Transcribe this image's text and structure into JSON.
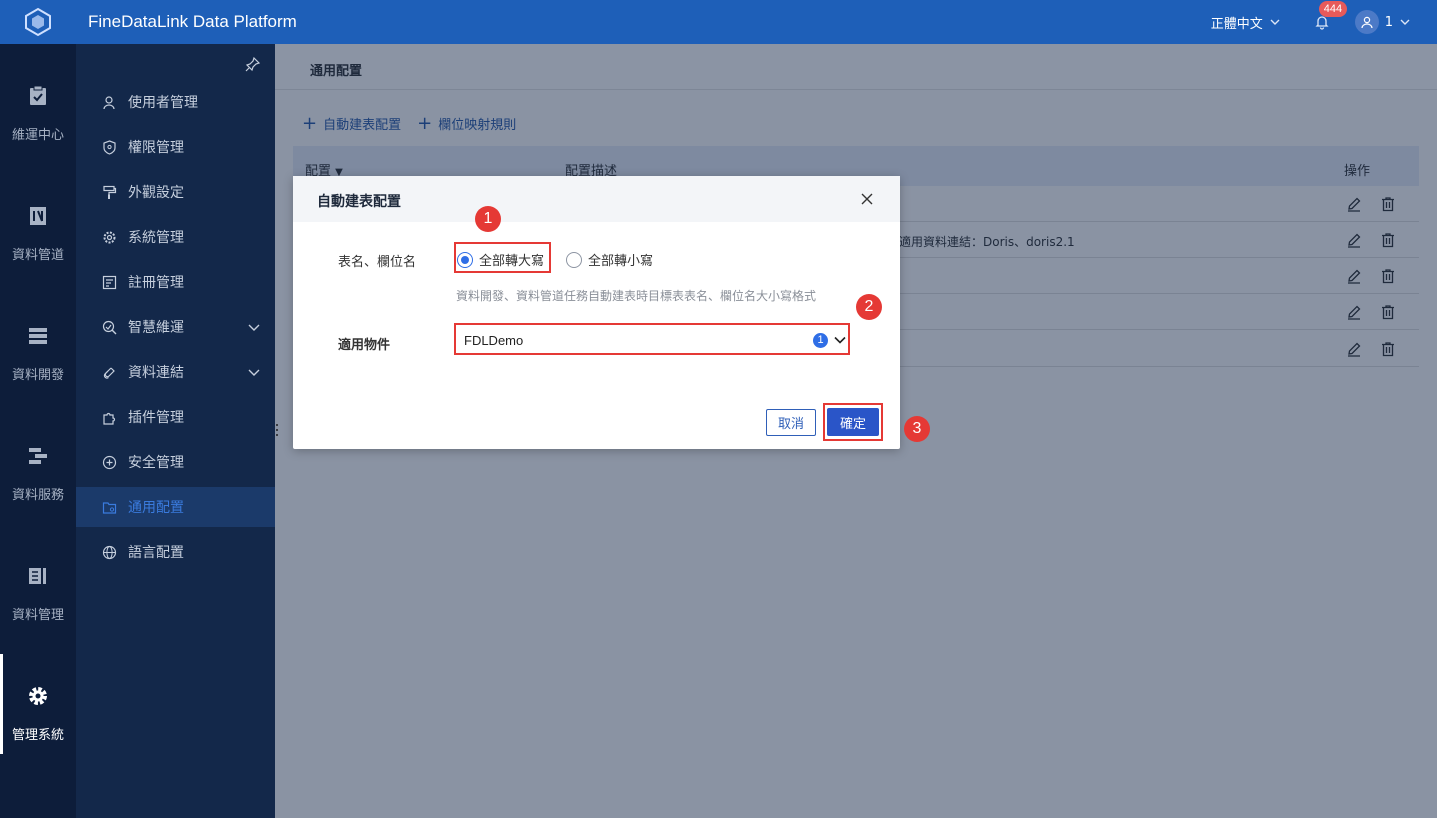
{
  "app": {
    "title": "FineDataLink Data Platform"
  },
  "topbar": {
    "language": "正體中文",
    "notification_count": "444",
    "user_name": "1"
  },
  "rail": {
    "items": [
      {
        "label": "維運中心",
        "icon": "clipboard-check-icon"
      },
      {
        "label": "資料管道",
        "icon": "pipeline-icon"
      },
      {
        "label": "資料開發",
        "icon": "server-stack-icon"
      },
      {
        "label": "資料服務",
        "icon": "service-icon"
      },
      {
        "label": "資料管理",
        "icon": "book-icon"
      },
      {
        "label": "管理系統",
        "icon": "gear-icon",
        "active": true
      }
    ]
  },
  "submenu": {
    "items": [
      {
        "label": "使用者管理",
        "icon": "user-icon"
      },
      {
        "label": "權限管理",
        "icon": "shield-icon"
      },
      {
        "label": "外觀設定",
        "icon": "paint-roller-icon"
      },
      {
        "label": "系統管理",
        "icon": "gear-icon"
      },
      {
        "label": "註冊管理",
        "icon": "register-icon"
      },
      {
        "label": "智慧維運",
        "icon": "smart-ops-icon",
        "expandable": true
      },
      {
        "label": "資料連結",
        "icon": "link-icon",
        "expandable": true
      },
      {
        "label": "插件管理",
        "icon": "puzzle-icon"
      },
      {
        "label": "安全管理",
        "icon": "security-plus-icon"
      },
      {
        "label": "通用配置",
        "icon": "folder-settings-icon",
        "active": true
      },
      {
        "label": "語言配置",
        "icon": "globe-icon"
      }
    ]
  },
  "main": {
    "breadcrumb": "通用配置",
    "toolbar": {
      "auto_table_label": "自動建表配置",
      "field_mapping_label": "欄位映射規則"
    },
    "table": {
      "headers": {
        "config": "配置",
        "desc": "配置描述",
        "ops": "操作"
      },
      "rows": [
        {
          "desc": ""
        },
        {
          "desc": "適用資料連結：Doris、doris2.1"
        },
        {
          "desc": ""
        },
        {
          "desc": ""
        },
        {
          "desc": ""
        }
      ]
    }
  },
  "modal": {
    "title": "自動建表配置",
    "field_case_label": "表名、欄位名",
    "option_upper": "全部轉大寫",
    "option_lower": "全部轉小寫",
    "hint": "資料開發、資料管道任務自動建表時目標表表名、欄位名大小寫格式",
    "applicable_label": "適用物件",
    "applicable_value": "FDLDemo",
    "applicable_count": "1",
    "cancel_label": "取消",
    "ok_label": "確定"
  },
  "steps": [
    "1",
    "2",
    "3"
  ],
  "colors": {
    "topbar": "#1e5fb8",
    "rail": "#0d1d3a",
    "submenu": "#13284a",
    "highlight": "#e53935",
    "primary": "#2a55c8"
  }
}
